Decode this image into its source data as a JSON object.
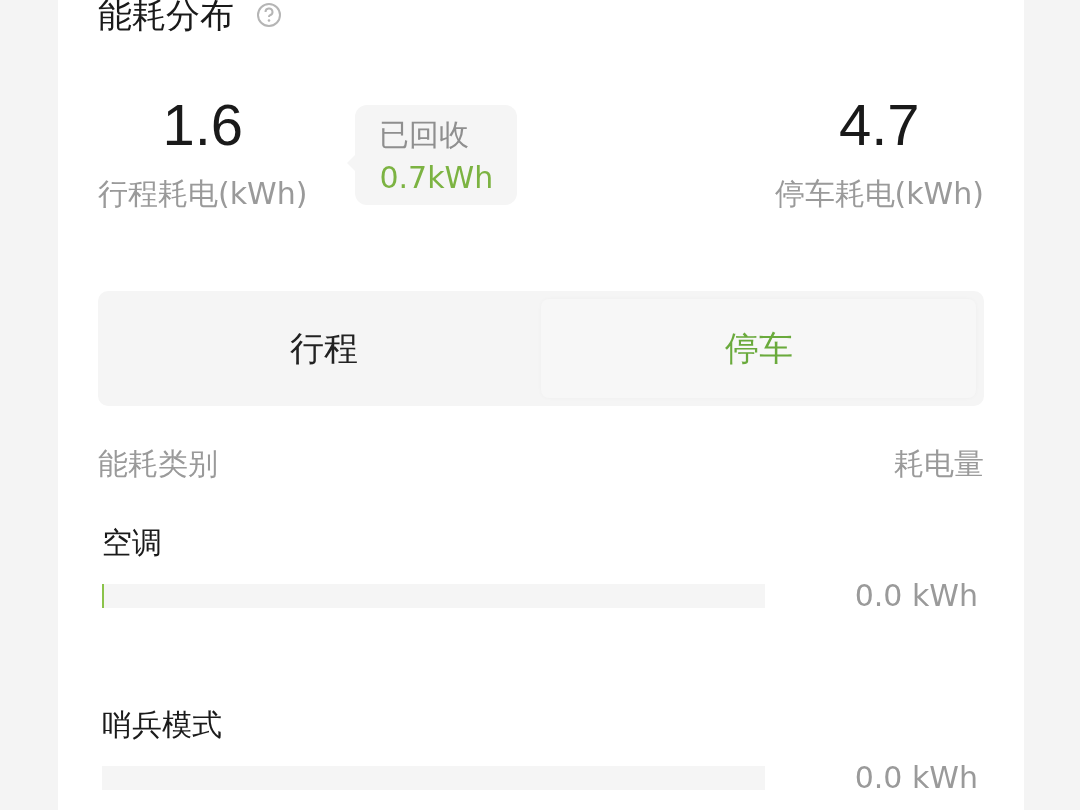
{
  "title": "能耗分布",
  "stats": {
    "trip": {
      "value": "1.6",
      "label": "行程耗电(kWh)"
    },
    "recovered": {
      "label": "已回收",
      "value": "0.7kWh"
    },
    "parking": {
      "value": "4.7",
      "label": "停车耗电(kWh)"
    }
  },
  "tabs": [
    {
      "label": "行程",
      "selected": false
    },
    {
      "label": "停车",
      "selected": true
    }
  ],
  "table": {
    "columns": [
      "能耗类别",
      "耗电量"
    ],
    "rows": [
      {
        "name": "空调",
        "level": 0.003,
        "reading": "0.0 kWh"
      },
      {
        "name": "哨兵模式",
        "reading": "0.0 kWh"
      }
    ]
  }
}
